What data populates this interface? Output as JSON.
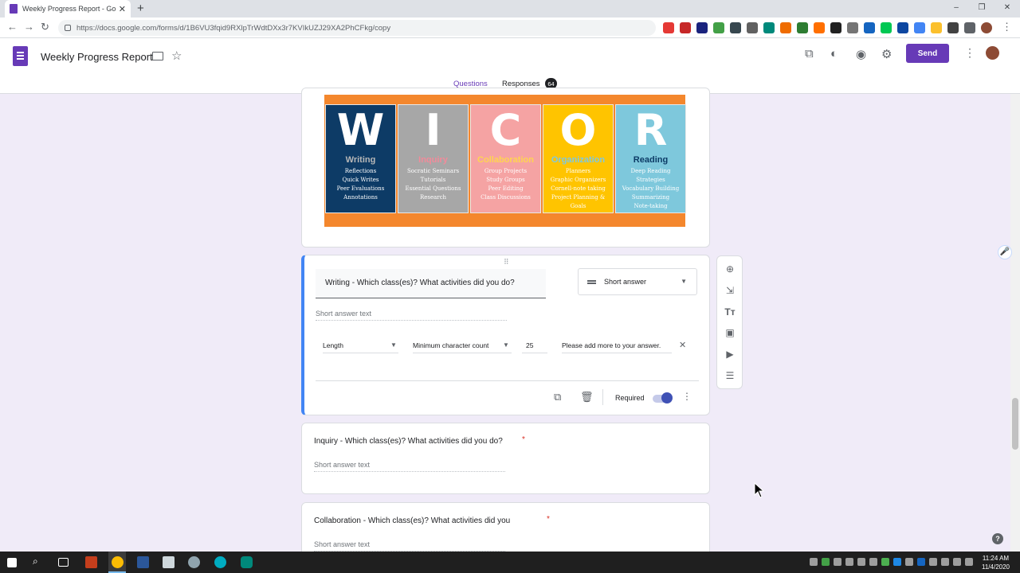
{
  "browser": {
    "tab_title": "Weekly Progress Report - Google",
    "tab_close": "✕",
    "new_tab": "+",
    "url": "https://docs.google.com/forms/d/1B6VU3fqid9RXlpTrWdtDXx3r7KVIkUZJ29XA2PhCFkg/copy",
    "window_controls": [
      "–",
      "❐",
      "✕"
    ]
  },
  "forms_header": {
    "doc_title": "Weekly Progress Report",
    "send_label": "Send",
    "tabs": {
      "questions": "Questions",
      "responses": "Responses",
      "responses_count": "64"
    }
  },
  "banner": {
    "panels": [
      {
        "letter": "W",
        "word": "Writing",
        "bg": "#0d3b66",
        "word_color": "#b8b8b8",
        "lines": [
          "Reflections",
          "Quick Writes",
          "Peer Evaluations",
          "Annotations"
        ]
      },
      {
        "letter": "I",
        "word": "Inquiry",
        "bg": "#a7a7a7",
        "word_color": "#f28b9a",
        "lines": [
          "Socratic Seminars",
          "Tutorials",
          "Essential Questions",
          "Research"
        ]
      },
      {
        "letter": "C",
        "word": "Collaboration",
        "bg": "#f5a3a3",
        "word_color": "#ffd54f",
        "lines": [
          "Group Projects",
          "Study Groups",
          "Peer Editing",
          "Class Discussions"
        ]
      },
      {
        "letter": "O",
        "word": "Organization",
        "bg": "#ffc400",
        "word_color": "#7ec8e3",
        "lines": [
          "Planners",
          "Graphic Organizers",
          "Cornell-note taking",
          "Project Planning & Goals"
        ]
      },
      {
        "letter": "R",
        "word": "Reading",
        "bg": "#7ec8dc",
        "word_color": "#0d3b66",
        "lines": [
          "Deep Reading Strategies",
          "Vocabulary Building",
          "Summarizing",
          "Note-taking"
        ]
      }
    ]
  },
  "active_question": {
    "title": "Writing - Which class(es)? What activities did you do?",
    "type": "Short answer",
    "answer_placeholder": "Short answer text",
    "validation": {
      "rule": "Length",
      "condition": "Minimum character count",
      "value": "25",
      "error_text": "Please add more to your answer."
    },
    "required_label": "Required"
  },
  "questions": [
    {
      "title": "Inquiry - Which class(es)? What activities did you do?",
      "required_mark": "*",
      "answer_placeholder": "Short answer text"
    },
    {
      "title": "Collaboration - Which class(es)? What activities did you",
      "required_mark": "*",
      "answer_placeholder": "Short answer text"
    }
  ],
  "icons": {
    "side_toolbar": [
      "add-question-icon",
      "import-questions-icon",
      "add-title-icon",
      "add-image-icon",
      "add-video-icon",
      "add-section-icon"
    ],
    "footer": [
      "duplicate-icon",
      "delete-icon",
      "more-vert-icon"
    ],
    "header": [
      "addons-icon",
      "palette-icon",
      "preview-icon",
      "settings-icon",
      "more-vert-icon"
    ]
  },
  "taskbar": {
    "time": "11:24 AM",
    "date": "11/4/2020"
  },
  "colors": {
    "accent": "#673ab7",
    "active_card_border": "#4285f4",
    "toggle": "#3f51b5",
    "banner_bg": "#f4872d"
  }
}
